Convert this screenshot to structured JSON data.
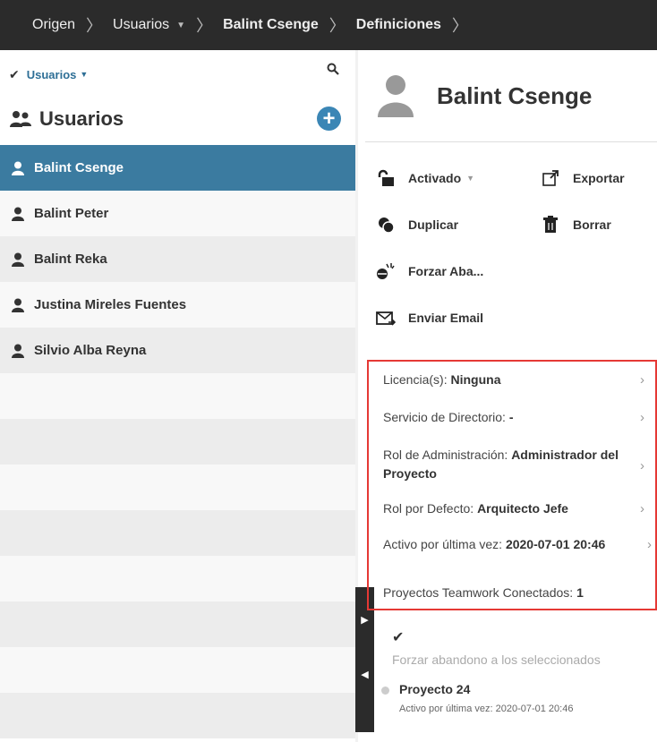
{
  "breadcrumb": [
    {
      "label": "Origen",
      "bold": false,
      "caret": false
    },
    {
      "label": "Usuarios",
      "bold": false,
      "caret": true
    },
    {
      "label": "Balint Csenge",
      "bold": true,
      "caret": false
    },
    {
      "label": "Definiciones",
      "bold": true,
      "caret": false
    }
  ],
  "filter": {
    "label": "Usuarios"
  },
  "panel": {
    "title": "Usuarios",
    "add_label": "+"
  },
  "users": [
    {
      "name": "Balint Csenge",
      "selected": true
    },
    {
      "name": "Balint Peter",
      "selected": false
    },
    {
      "name": "Balint Reka",
      "selected": false
    },
    {
      "name": "Justina Mireles Fuentes",
      "selected": false
    },
    {
      "name": "Silvio Alba Reyna",
      "selected": false
    }
  ],
  "detail": {
    "name": "Balint Csenge",
    "actions": {
      "activated": "Activado",
      "export": "Exportar",
      "duplicate": "Duplicar",
      "delete": "Borrar",
      "force_leave": "Forzar Aba...",
      "send_email": "Enviar Email"
    },
    "info": {
      "license_label": "Licencia(s):",
      "license_value": "Ninguna",
      "directory_label": "Servicio de Directorio:",
      "directory_value": "-",
      "admin_role_label": "Rol de Administración:",
      "admin_role_value": "Administrador del Proyecto",
      "default_role_label": "Rol por Defecto:",
      "default_role_value": "Arquitecto Jefe",
      "last_active_label": "Activo por última vez:",
      "last_active_value": "2020-07-01 20:46",
      "projects_label": "Proyectos Teamwork Conectados:",
      "projects_value": "1"
    },
    "force_selected_label": "Forzar abandono a los seleccionados",
    "project": {
      "name": "Proyecto 24",
      "last_active": "Activo por última vez: 2020-07-01 20:46"
    }
  },
  "colors": {
    "topbar": "#2b2b2b",
    "selected_row": "#3b7ba0",
    "accent": "#3b86b5",
    "highlight_border": "#e53935"
  }
}
